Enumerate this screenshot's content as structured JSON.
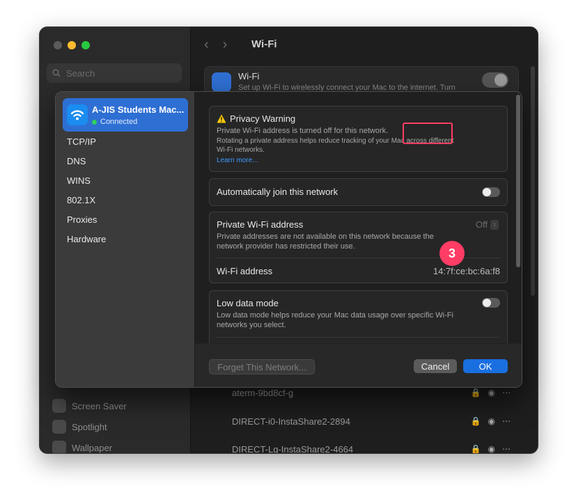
{
  "window": {
    "title": "Wi-Fi"
  },
  "sidebar": {
    "search_placeholder": "Search",
    "bg_items": [
      "Screen Saver",
      "Spotlight",
      "Wallpaper"
    ]
  },
  "wifi_card": {
    "title": "Wi-Fi",
    "subtitle": "Set up Wi-Fi to wirelessly connect your Mac to the internet. Turn"
  },
  "bg_networks": [
    {
      "name": "aterm-9bd8cf-g"
    },
    {
      "name": "DIRECT-i0-InstaShare2-2894"
    },
    {
      "name": "DIRECT-Lg-InstaShare2-4664"
    }
  ],
  "sheet": {
    "network": {
      "name": "A-JIS Students Mac...",
      "status": "Connected"
    },
    "nav": [
      "TCP/IP",
      "DNS",
      "WINS",
      "802.1X",
      "Proxies",
      "Hardware"
    ],
    "privacy_warning": {
      "title": "Privacy Warning",
      "line1": "Private Wi-Fi address is turned off for this network.",
      "line2": "Rotating a private address helps reduce tracking of your Mac across different",
      "line3": "Wi-Fi networks.",
      "link": "Learn more..."
    },
    "auto_join": {
      "label": "Automatically join this network"
    },
    "private_address": {
      "label": "Private Wi-Fi address",
      "value": "Off",
      "desc1": "Private addresses are not available on this network because the",
      "desc2": "network provider has restricted their use.",
      "wifi_address_label": "Wi-Fi address",
      "wifi_address_value": "14:7f:ce:bc:6a:f8"
    },
    "low_data": {
      "label": "Low data mode",
      "desc1": "Low data mode helps reduce your Mac data usage over specific Wi-Fi",
      "desc2": "networks you select."
    },
    "buttons": {
      "forget": "Forget This Network...",
      "cancel": "Cancel",
      "ok": "OK"
    }
  },
  "annotation": {
    "step": "3",
    "color": "#ff3d64"
  },
  "colors": {
    "accent": "#2e6fd4",
    "ok": "#1a6fe0"
  }
}
